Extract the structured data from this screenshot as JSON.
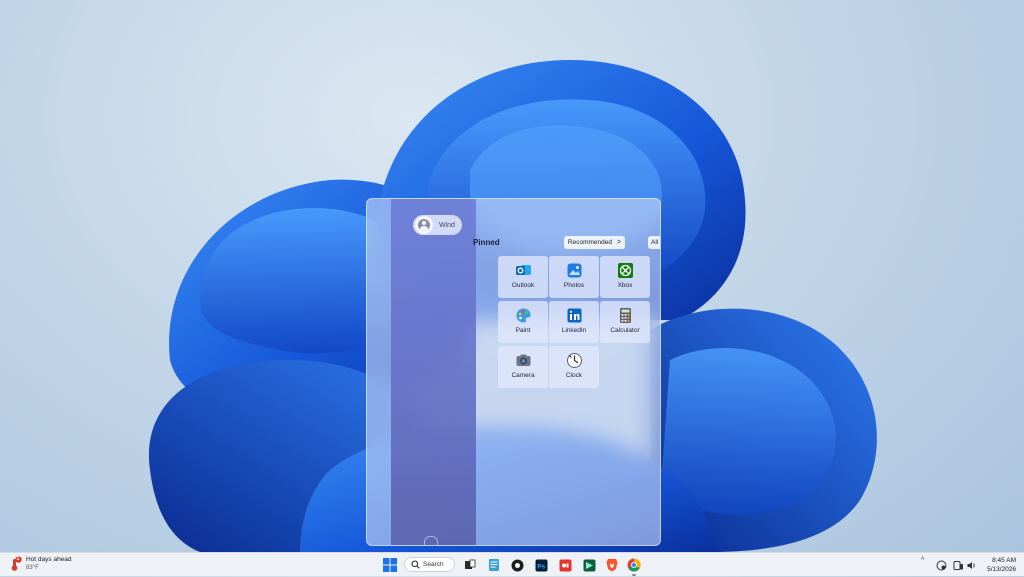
{
  "user": {
    "name": "Wind"
  },
  "start_menu": {
    "pinned_label": "Pinned",
    "recommended_label": "Recommended",
    "recommended_chevron": ">",
    "all_label": "All",
    "apps": [
      {
        "label": "Outlook",
        "icon": "outlook-icon"
      },
      {
        "label": "Photos",
        "icon": "photos-icon"
      },
      {
        "label": "Xbox",
        "icon": "xbox-icon"
      },
      {
        "label": "Paint",
        "icon": "paint-icon"
      },
      {
        "label": "LinkedIn",
        "icon": "linkedin-icon"
      },
      {
        "label": "Calculator",
        "icon": "calculator-icon"
      },
      {
        "label": "Camera",
        "icon": "camera-icon"
      },
      {
        "label": "Clock",
        "icon": "clock-icon"
      }
    ]
  },
  "taskbar": {
    "weather": {
      "headline": "Hot days ahead",
      "temp": "83°F",
      "badge": "1"
    },
    "search_label": "Search",
    "apps": [
      "start-icon",
      "search-icon",
      "task-view-icon",
      "notepad-icon",
      "media-player-icon",
      "photoshop-icon",
      "app-red-icon",
      "app-green-icon",
      "brave-icon",
      "chrome-icon"
    ],
    "tray": {
      "chevron": "^"
    },
    "clock": {
      "time": "8:45 AM",
      "date": "5/13/2026"
    }
  },
  "colors": {
    "accent": "#1e6fd9",
    "taskbar": "#eef1f6",
    "side_panel": "#6471c6"
  }
}
